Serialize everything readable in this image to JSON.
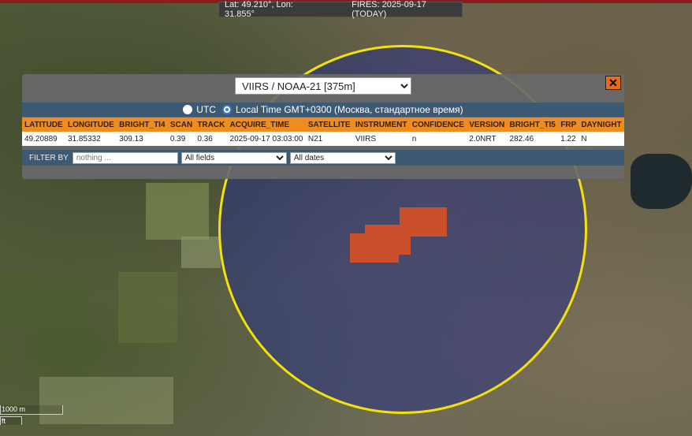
{
  "header": {
    "coords": "Lat: 49.210°, Lon: 31.855°",
    "fires": "FIRES: 2025-09-17 (TODAY)"
  },
  "panel": {
    "product": "VIIRS / NOAA-21 [375m]",
    "close": "✕",
    "tz_utc": "UTC",
    "tz_local": "Local Time GMT+0300 (Москва, стандартное время)",
    "columns": [
      "LATITUDE",
      "LONGITUDE",
      "BRIGHT_TI4",
      "SCAN",
      "TRACK",
      "ACQUIRE_TIME",
      "SATELLITE",
      "INSTRUMENT",
      "CONFIDENCE",
      "VERSION",
      "BRIGHT_TI5",
      "FRP",
      "DAYNIGHT"
    ],
    "row": [
      "49.20889",
      "31.85332",
      "309.13",
      "0.39",
      "0.36",
      "2025-09-17 03:03:00",
      "N21",
      "VIIRS",
      "n",
      "2.0NRT",
      "282.46",
      "1.22",
      "N"
    ],
    "filter_label": "FILTER BY",
    "filter_placeholder": "nothing ...",
    "field_select": "All fields",
    "date_select": "All dates"
  },
  "map": {
    "scale_metric": "1000 m",
    "scale_imperial": "ft",
    "circle_color": "#f4e10a",
    "hotspot_color": "#c9502b"
  }
}
